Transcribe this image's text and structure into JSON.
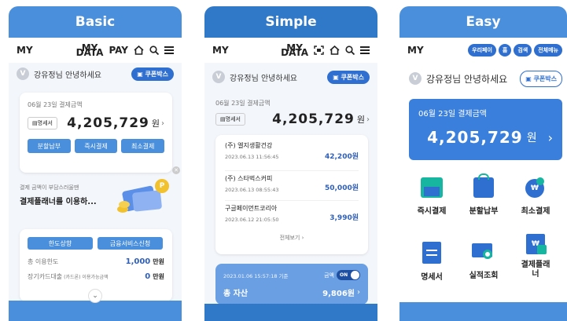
{
  "panels": [
    {
      "header": "Basic",
      "appbar": {
        "my": "MY",
        "my_data": "MY\nDATA",
        "pay": "PAY"
      },
      "greeting": "강유정님 안녕하세요",
      "coupon": "쿠폰박스",
      "date_label": "06월 23일 결제금액",
      "statement": "명세서",
      "amount": "4,205,729",
      "won": "원",
      "buttons": [
        "분할납부",
        "즉시결제",
        "최소결제"
      ],
      "promo_line1": "결제 금액이 부담스러울땐",
      "promo_line2": "결제플래너를 이용하...",
      "tabs": [
        "한도상향",
        "금융서비스신청"
      ],
      "limit_label": "총 이용한도",
      "limit_value": "1,000",
      "limit_unit": "만원",
      "card_loan_label": "장기카드대출",
      "card_loan_sub": "(카드론)",
      "card_loan_extra": "이용가능금액",
      "card_loan_value": "0",
      "card_loan_unit": "만원"
    },
    {
      "header": "Simple",
      "appbar": {
        "my": "MY",
        "my_data": "MY\nDATA"
      },
      "greeting": "강유정님 안녕하세요",
      "coupon": "쿠폰박스",
      "date_label": "06월 23일 결제금액",
      "statement": "명세서",
      "amount": "4,205,729",
      "won": "원",
      "transactions": [
        {
          "merchant": "(주) 엘지생활건강",
          "datetime": "2023.06.13 11:56:45",
          "amount": "42,200원"
        },
        {
          "merchant": "(주) 스타벅스커피",
          "datetime": "2023.06.13 08:55:43",
          "amount": "50,000원"
        },
        {
          "merchant": "구글페이먼트코리아",
          "datetime": "2023.06.12 21:05:50",
          "amount": "3,990원"
        }
      ],
      "view_all": "전체보기",
      "asset_time": "2023.01.06 15:57:18 기준",
      "asset_toggle_label": "금액",
      "asset_toggle_state": "ON",
      "asset_label": "총 자산",
      "asset_value": "9,806원"
    },
    {
      "header": "Easy",
      "appbar": {
        "my": "MY",
        "chips": [
          "우리페이",
          "홈",
          "검색",
          "전체메뉴"
        ]
      },
      "greeting": "강유정님 안녕하세요",
      "coupon": "쿠폰박스",
      "date_label": "06월 23일 결제금액",
      "amount": "4,205,729",
      "won": "원",
      "menu": [
        {
          "label": "즉시결제",
          "icon": "card-pay-icon"
        },
        {
          "label": "분할납부",
          "icon": "shopping-bag-icon"
        },
        {
          "label": "최소결제",
          "icon": "coin-icon"
        },
        {
          "label": "명세서",
          "icon": "document-icon"
        },
        {
          "label": "실적조회",
          "icon": "search-screen-icon"
        },
        {
          "label": "결제플래\n너",
          "icon": "planner-icon"
        }
      ]
    }
  ]
}
